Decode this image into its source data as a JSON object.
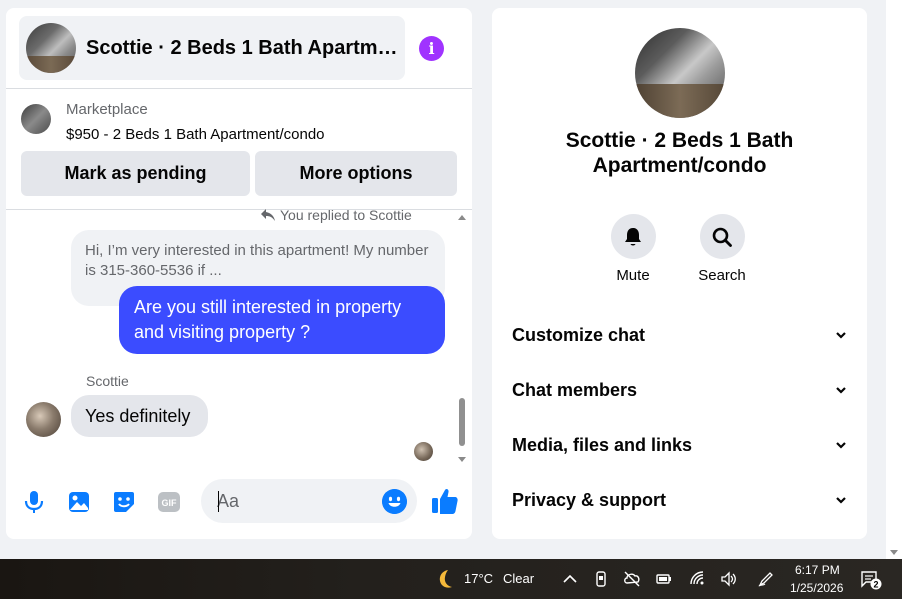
{
  "chat": {
    "title": "Scottie · 2 Beds 1 Bath Apartm…",
    "info_icon": "info-icon",
    "marketplace_label": "Marketplace",
    "listing": "$950 - 2 Beds 1 Bath Apartment/condo",
    "mark_pending_label": "Mark as pending",
    "more_options_label": "More options"
  },
  "messages": {
    "replied_note": "You replied to Scottie",
    "quoted_text": "Hi, I’m very interested in this apartment! My number is 315-360-5536 if ...",
    "my_message": "Are you still interested in property and visiting property ?",
    "sender_name": "Scottie",
    "their_message": "Yes definitely"
  },
  "composer": {
    "placeholder": "Aa",
    "icons": [
      "microphone-icon",
      "image-icon",
      "sticker-icon",
      "gif-icon",
      "emoji-icon",
      "thumbs-up-icon"
    ]
  },
  "profile": {
    "name": "Scottie · 2 Beds 1 Bath Apartment/condo",
    "mute_label": "Mute",
    "search_label": "Search",
    "sections": [
      {
        "title": "Customize chat"
      },
      {
        "title": "Chat members"
      },
      {
        "title": "Media, files and links"
      },
      {
        "title": "Privacy & support"
      }
    ]
  },
  "taskbar": {
    "temperature": "17°C",
    "condition": "Clear",
    "time": "6:17 PM",
    "date": "1/25/2026",
    "notification_count": "2"
  },
  "colors": {
    "accent_blue": "#0a7cff",
    "my_bubble": "#3b4cff",
    "info_purple": "#a033ff",
    "panel_bg": "#f0f2f5"
  }
}
